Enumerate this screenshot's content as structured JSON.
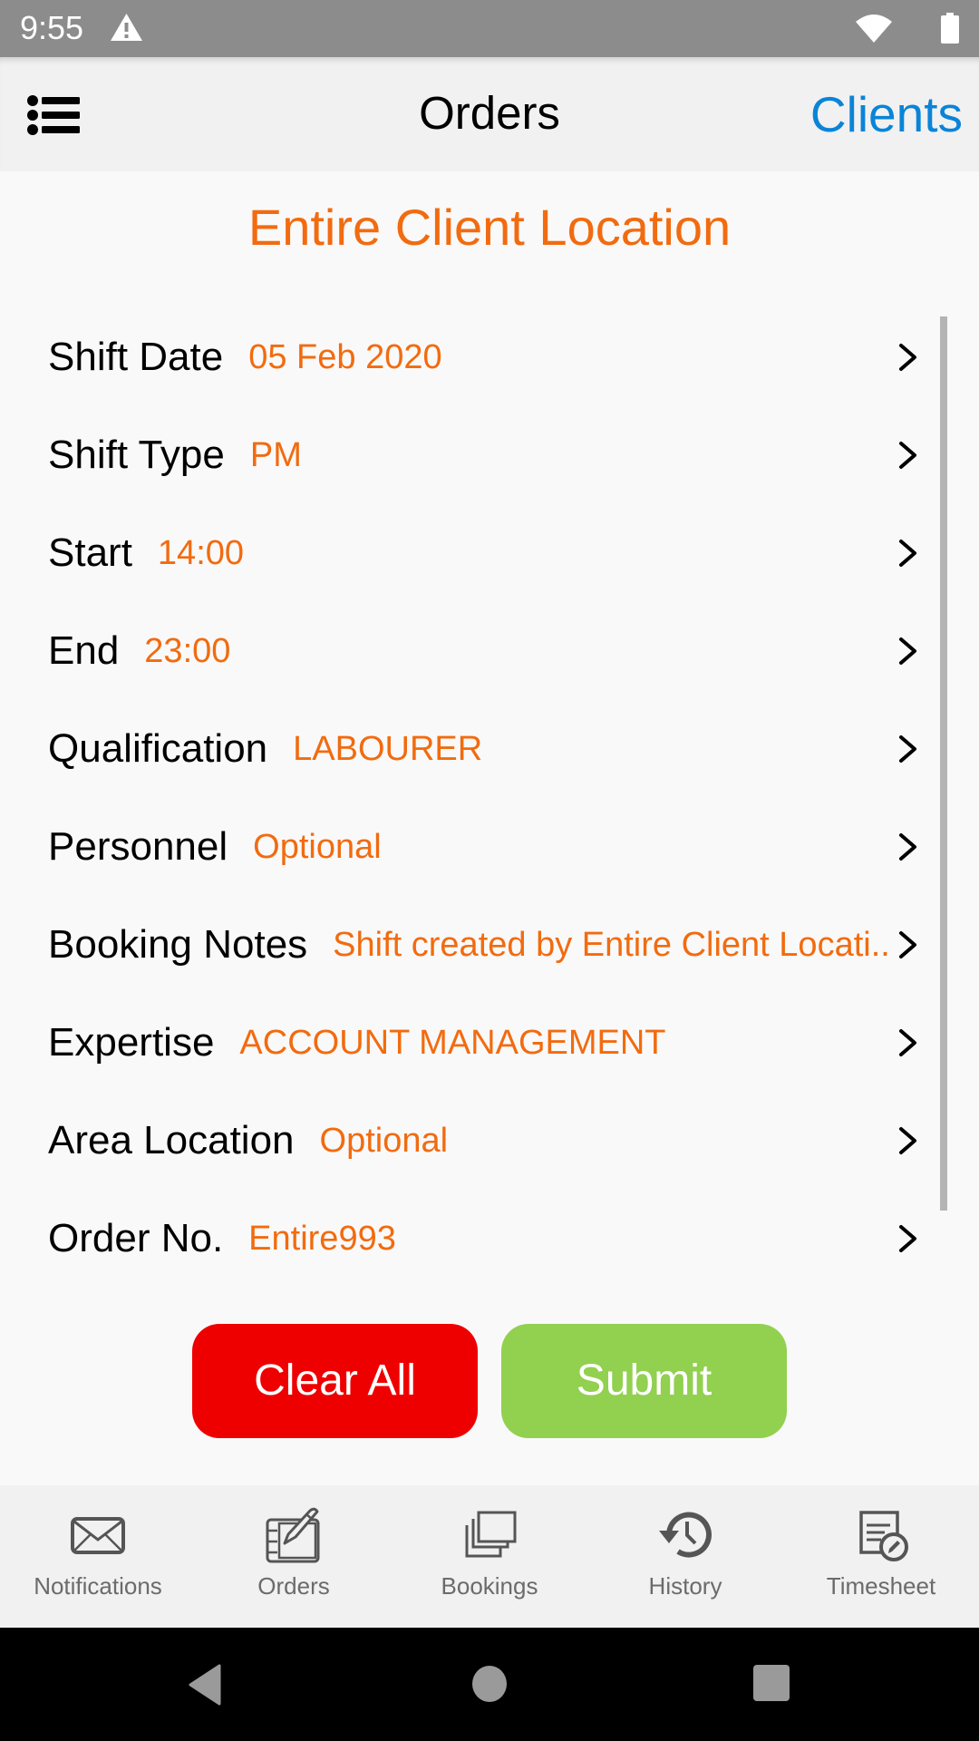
{
  "status_bar": {
    "time": "9:55",
    "icons": [
      "warning-icon",
      "wifi-icon",
      "battery-icon"
    ]
  },
  "header": {
    "menu_icon": "list-menu-icon",
    "title": "Orders",
    "right_link": "Clients"
  },
  "location_title": "Entire Client Location",
  "form": {
    "rows": [
      {
        "label": "Shift Date",
        "value": "05 Feb 2020"
      },
      {
        "label": "Shift Type",
        "value": "PM"
      },
      {
        "label": "Start",
        "value": "14:00"
      },
      {
        "label": "End",
        "value": "23:00"
      },
      {
        "label": "Qualification",
        "value": "LABOURER"
      },
      {
        "label": "Personnel",
        "value": "Optional"
      },
      {
        "label": "Booking Notes",
        "value": "Shift created by Entire Client Locati.."
      },
      {
        "label": "Expertise",
        "value": "ACCOUNT MANAGEMENT"
      },
      {
        "label": "Area Location",
        "value": "Optional"
      },
      {
        "label": "Order No.",
        "value": "Entire993"
      }
    ]
  },
  "actions": {
    "clear_label": "Clear All",
    "submit_label": "Submit"
  },
  "bottom_nav": {
    "items": [
      {
        "label": "Notifications",
        "icon": "envelope-icon"
      },
      {
        "label": "Orders",
        "icon": "tablet-pen-icon"
      },
      {
        "label": "Bookings",
        "icon": "stacked-windows-icon"
      },
      {
        "label": "History",
        "icon": "history-clock-icon"
      },
      {
        "label": "Timesheet",
        "icon": "timesheet-edit-icon"
      }
    ]
  },
  "colors": {
    "accent_orange": "#f26b0f",
    "link_blue": "#0a84d8",
    "clear_red": "#ee0000",
    "submit_green": "#92d050"
  }
}
